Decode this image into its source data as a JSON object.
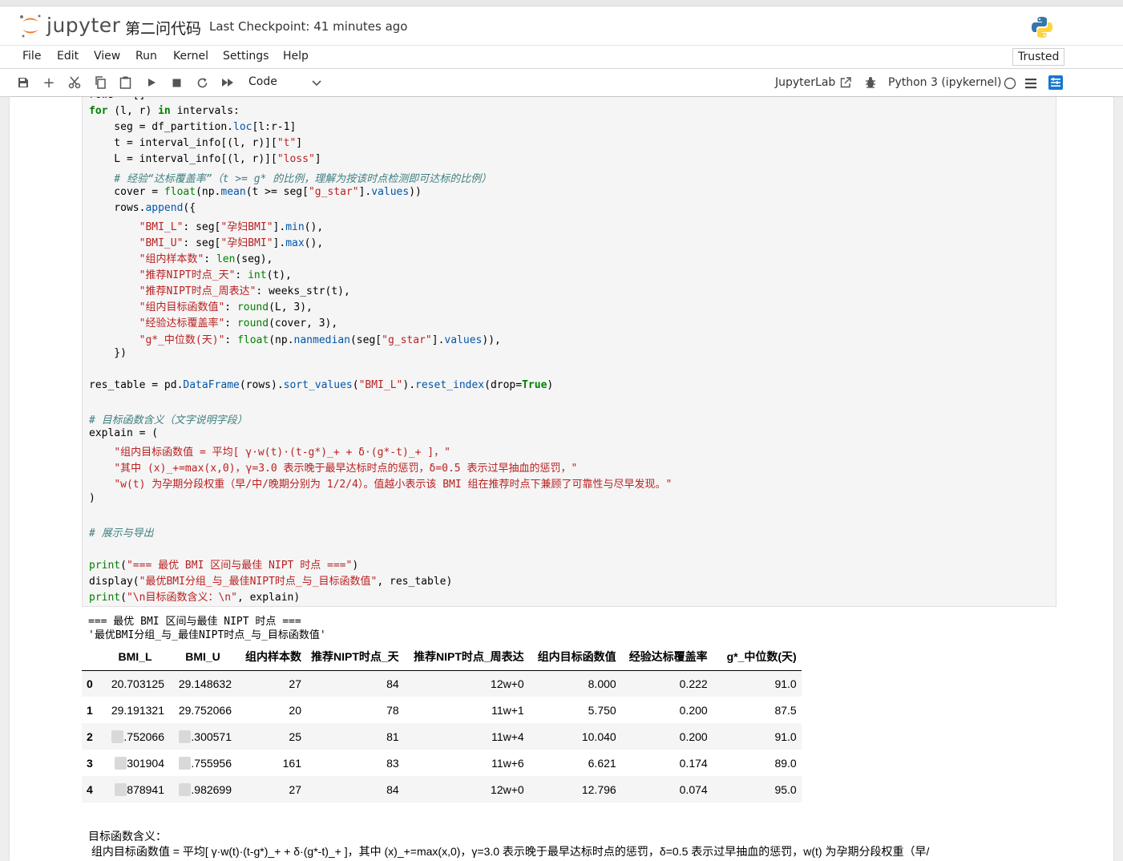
{
  "header": {
    "brand": "jupyter",
    "notebook_title": "第二问代码",
    "checkpoint": "Last Checkpoint: 41 minutes ago"
  },
  "menu": {
    "items": [
      "File",
      "Edit",
      "View",
      "Run",
      "Kernel",
      "Settings",
      "Help"
    ],
    "trusted": "Trusted"
  },
  "toolbar": {
    "cell_type": "Code",
    "jupyterlab_label": "JupyterLab",
    "kernel_name": "Python 3 (ipykernel)",
    "icons": [
      "save-icon",
      "add-cell-icon",
      "cut-icon",
      "copy-icon",
      "paste-icon",
      "run-icon",
      "stop-icon",
      "restart-icon",
      "fast-forward-icon"
    ]
  },
  "code_lines": [
    [
      [
        "rows = []",
        ""
      ]
    ],
    [
      [
        "for",
        "kw"
      ],
      [
        " (l, r) ",
        ""
      ],
      [
        "in",
        "kw"
      ],
      [
        " intervals:",
        ""
      ]
    ],
    [
      [
        "    seg = df_partition.",
        ""
      ],
      [
        "loc",
        "attr"
      ],
      [
        "[l:r-1]",
        ""
      ]
    ],
    [
      [
        "    t = interval_info[(l, r)][",
        ""
      ],
      [
        "\"t\"",
        "str"
      ],
      [
        "]",
        ""
      ]
    ],
    [
      [
        "    L = interval_info[(l, r)][",
        ""
      ],
      [
        "\"loss\"",
        "str"
      ],
      [
        "]",
        ""
      ]
    ],
    [
      [
        "    # 经验“达标覆盖率”（t >= g* 的比例，理解为按该时点检测即可达标的比例）",
        "com"
      ]
    ],
    [
      [
        "    cover = ",
        ""
      ],
      [
        "float",
        "fn"
      ],
      [
        "(np.",
        ""
      ],
      [
        "mean",
        "attr"
      ],
      [
        "(t >= seg[",
        ""
      ],
      [
        "\"g_star\"",
        "str"
      ],
      [
        "].",
        ""
      ],
      [
        "values",
        "attr"
      ],
      [
        "))",
        ""
      ]
    ],
    [
      [
        "    rows.",
        ""
      ],
      [
        "append",
        "attr"
      ],
      [
        "({",
        ""
      ]
    ],
    [
      [
        "        ",
        ""
      ],
      [
        "\"BMI_L\"",
        "str"
      ],
      [
        ": seg[",
        ""
      ],
      [
        "\"孕妇BMI\"",
        "str"
      ],
      [
        "].",
        ""
      ],
      [
        "min",
        "attr"
      ],
      [
        "(),",
        ""
      ]
    ],
    [
      [
        "        ",
        ""
      ],
      [
        "\"BMI_U\"",
        "str"
      ],
      [
        ": seg[",
        ""
      ],
      [
        "\"孕妇BMI\"",
        "str"
      ],
      [
        "].",
        ""
      ],
      [
        "max",
        "attr"
      ],
      [
        "(),",
        ""
      ]
    ],
    [
      [
        "        ",
        ""
      ],
      [
        "\"组内样本数\"",
        "str"
      ],
      [
        ": ",
        ""
      ],
      [
        "len",
        "fn"
      ],
      [
        "(seg),",
        ""
      ]
    ],
    [
      [
        "        ",
        ""
      ],
      [
        "\"推荐NIPT时点_天\"",
        "str"
      ],
      [
        ": ",
        ""
      ],
      [
        "int",
        "fn"
      ],
      [
        "(t),",
        ""
      ]
    ],
    [
      [
        "        ",
        ""
      ],
      [
        "\"推荐NIPT时点_周表达\"",
        "str"
      ],
      [
        ": weeks_str(t),",
        ""
      ]
    ],
    [
      [
        "        ",
        ""
      ],
      [
        "\"组内目标函数值\"",
        "str"
      ],
      [
        ": ",
        ""
      ],
      [
        "round",
        "fn"
      ],
      [
        "(L, 3),",
        ""
      ]
    ],
    [
      [
        "        ",
        ""
      ],
      [
        "\"经验达标覆盖率\"",
        "str"
      ],
      [
        ": ",
        ""
      ],
      [
        "round",
        "fn"
      ],
      [
        "(cover, 3),",
        ""
      ]
    ],
    [
      [
        "        ",
        ""
      ],
      [
        "\"g*_中位数(天)\"",
        "str"
      ],
      [
        ": ",
        ""
      ],
      [
        "float",
        "fn"
      ],
      [
        "(np.",
        ""
      ],
      [
        "nanmedian",
        "attr"
      ],
      [
        "(seg[",
        ""
      ],
      [
        "\"g_star\"",
        "str"
      ],
      [
        "].",
        ""
      ],
      [
        "values",
        "attr"
      ],
      [
        ")),",
        ""
      ]
    ],
    [
      [
        "    })",
        ""
      ]
    ],
    [
      [
        "",
        ""
      ]
    ],
    [
      [
        "res_table = pd.",
        ""
      ],
      [
        "DataFrame",
        "attr"
      ],
      [
        "(rows).",
        ""
      ],
      [
        "sort_values",
        "attr"
      ],
      [
        "(",
        ""
      ],
      [
        "\"BMI_L\"",
        "str"
      ],
      [
        ").",
        ""
      ],
      [
        "reset_index",
        "attr"
      ],
      [
        "(drop=",
        ""
      ],
      [
        "True",
        "kw"
      ],
      [
        ")",
        ""
      ]
    ],
    [
      [
        "",
        ""
      ]
    ],
    [
      [
        "# 目标函数含义（文字说明字段）",
        "com"
      ]
    ],
    [
      [
        "explain = (",
        ""
      ]
    ],
    [
      [
        "    ",
        ""
      ],
      [
        "\"组内目标函数值 = 平均[ γ·w(t)·(t-g*)_+ + δ·(g*-t)_+ ]，\"",
        "str"
      ]
    ],
    [
      [
        "    ",
        ""
      ],
      [
        "\"其中 (x)_+=max(x,0)，γ=3.0 表示晚于最早达标时点的惩罚，δ=0.5 表示过早抽血的惩罚，\"",
        "str"
      ]
    ],
    [
      [
        "    ",
        ""
      ],
      [
        "\"w(t) 为孕期分段权重（早/中/晚期分别为 1/2/4）。值越小表示该 BMI 组在推荐时点下兼顾了可靠性与尽早发现。\"",
        "str"
      ]
    ],
    [
      [
        ")",
        ""
      ]
    ],
    [
      [
        "",
        ""
      ]
    ],
    [
      [
        "# 展示与导出",
        "com"
      ]
    ],
    [
      [
        "",
        ""
      ]
    ],
    [
      [
        "print",
        "fn"
      ],
      [
        "(",
        ""
      ],
      [
        "\"=== 最优 BMI 区间与最佳 NIPT 时点 ===\"",
        "str"
      ],
      [
        ")",
        ""
      ]
    ],
    [
      [
        "display(",
        ""
      ],
      [
        "\"最优BMI分组_与_最佳NIPT时点_与_目标函数值\"",
        "str"
      ],
      [
        ", res_table)",
        ""
      ]
    ],
    [
      [
        "print",
        "fn"
      ],
      [
        "(",
        ""
      ],
      [
        "\"\\n目标函数含义：\\n\"",
        "str"
      ],
      [
        ", explain)",
        ""
      ]
    ]
  ],
  "output": {
    "stdout_line": "=== 最优 BMI 区间与最佳 NIPT 时点 ===",
    "display_repr": "'最优BMI分组_与_最佳NIPT时点_与_目标函数值'",
    "table": {
      "columns": [
        "",
        "BMI_L",
        "BMI_U",
        "组内样本数",
        "推荐NIPT时点_天",
        "推荐NIPT时点_周表达",
        "组内目标函数值",
        "经验达标覆盖率",
        "g*_中位数(天)"
      ],
      "rows": [
        {
          "index": "0",
          "bmi_l": "20.703125",
          "bmi_u": "29.148632",
          "n": "27",
          "days": "84",
          "weeks": "12w+0",
          "obj": "8.000",
          "cover": "0.222",
          "median": "91.0"
        },
        {
          "index": "1",
          "bmi_l": "29.191321",
          "bmi_u": "29.752066",
          "n": "20",
          "days": "78",
          "weeks": "11w+1",
          "obj": "5.750",
          "cover": "0.200",
          "median": "87.5"
        },
        {
          "index": "2",
          "bmi_l": ".752066",
          "bmi_u": ".300571",
          "n": "25",
          "days": "81",
          "weeks": "11w+4",
          "obj": "10.040",
          "cover": "0.200",
          "median": "91.0"
        },
        {
          "index": "3",
          "bmi_l": "301904",
          "bmi_u": ".755956",
          "n": "161",
          "days": "83",
          "weeks": "11w+6",
          "obj": "6.621",
          "cover": "0.174",
          "median": "89.0"
        },
        {
          "index": "4",
          "bmi_l": "878941",
          "bmi_u": ".982699",
          "n": "27",
          "days": "84",
          "weeks": "12w+0",
          "obj": "12.796",
          "cover": "0.074",
          "median": "95.0"
        }
      ]
    },
    "explain_title": "目标函数含义：",
    "explain_line": " 组内目标函数值 = 平均[ γ·w(t)·(t-g*)_+ + δ·(g*-t)_+ ]，其中 (x)_+=max(x,0)，γ=3.0 表示晚于最早达标时点的惩罚，δ=0.5 表示过早抽血的惩罚，w(t) 为孕期分段权重（早/"
  }
}
